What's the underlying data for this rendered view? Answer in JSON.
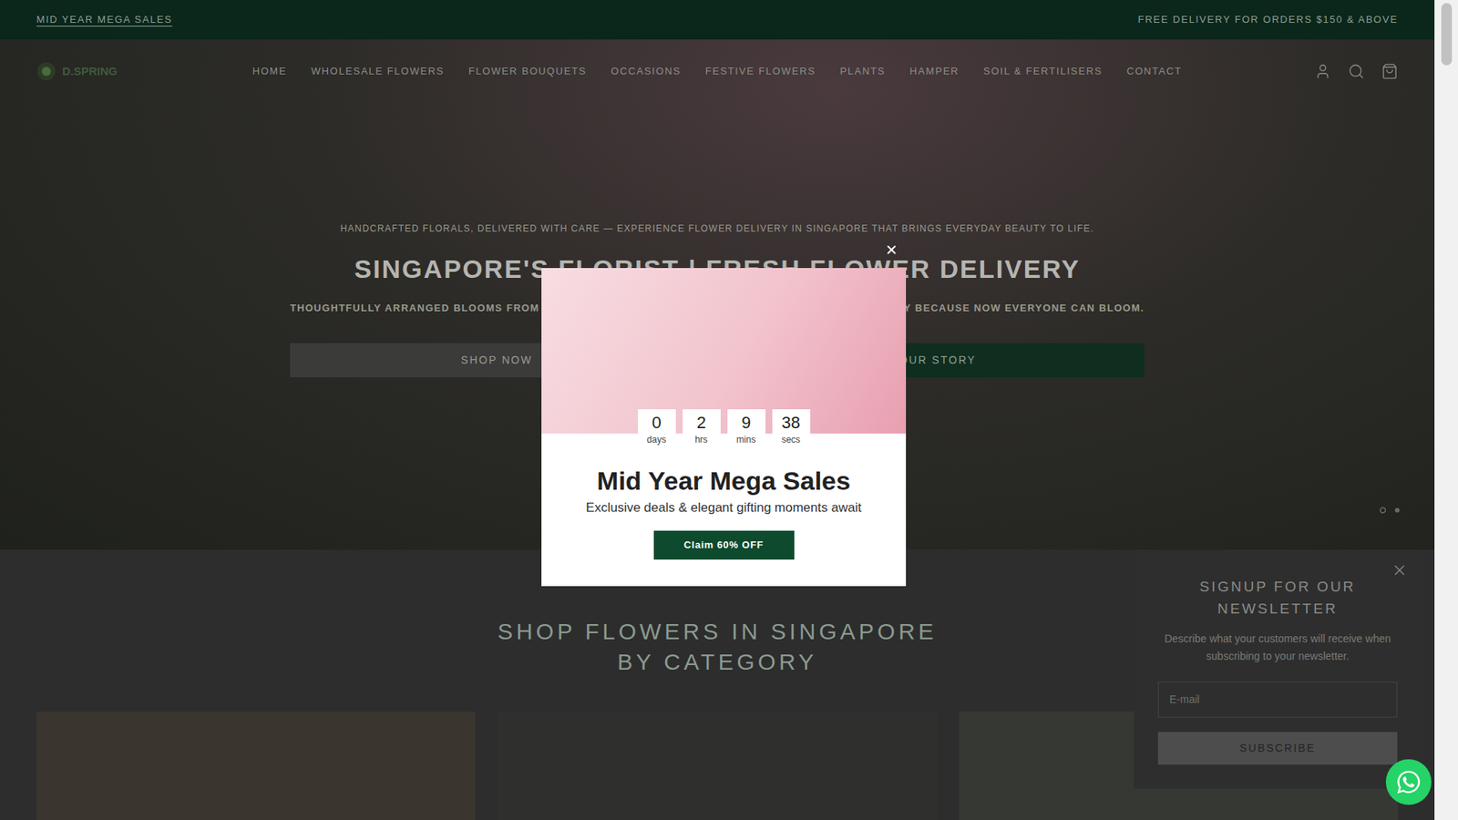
{
  "announcement": {
    "left": "MID YEAR MEGA SALES",
    "right": "FREE DELIVERY FOR ORDERS $150 & ABOVE"
  },
  "logo": {
    "text": "D.SPRING"
  },
  "nav": [
    {
      "label": "HOME"
    },
    {
      "label": "WHOLESALE FLOWERS"
    },
    {
      "label": "FLOWER BOUQUETS"
    },
    {
      "label": "OCCASIONS"
    },
    {
      "label": "FESTIVE FLOWERS"
    },
    {
      "label": "PLANTS"
    },
    {
      "label": "HAMPER"
    },
    {
      "label": "SOIL & FERTILISERS"
    },
    {
      "label": "CONTACT"
    }
  ],
  "hero": {
    "kicker": "HANDCRAFTED FLORALS, DELIVERED WITH CARE — EXPERIENCE FLOWER DELIVERY IN SINGAPORE THAT BRINGS EVERYDAY BEAUTY TO LIFE.",
    "title": "SINGAPORE'S FLORIST | FRESH FLOWER DELIVERY",
    "subtitle_left": "THOUGHTFULLY ARRANGED BLOOMS FROM",
    "subtitle_right": "Y BECAUSE NOW EVERYONE CAN BLOOM.",
    "buttons": [
      "SHOP NOW",
      "OUR STORY"
    ],
    "slides": [
      {
        "selected": true
      },
      {
        "selected": false
      }
    ]
  },
  "category_section": {
    "title": "SHOP FLOWERS IN SINGAPORE BY CATEGORY"
  },
  "popup": {
    "countdown": [
      {
        "value": "0",
        "unit": "days"
      },
      {
        "value": "2",
        "unit": "hrs"
      },
      {
        "value": "9",
        "unit": "mins"
      },
      {
        "value": "38",
        "unit": "secs"
      }
    ],
    "title": "Mid Year Mega Sales",
    "subtitle": "Exclusive deals & elegant gifting moments await",
    "button": "Claim 60% OFF"
  },
  "newsletter": {
    "title": "SIGNUP FOR OUR NEWSLETTER",
    "description": "Describe what your customers will receive when subscribing to your newsletter.",
    "email_placeholder": "E-mail",
    "button": "SUBSCRIBE"
  }
}
